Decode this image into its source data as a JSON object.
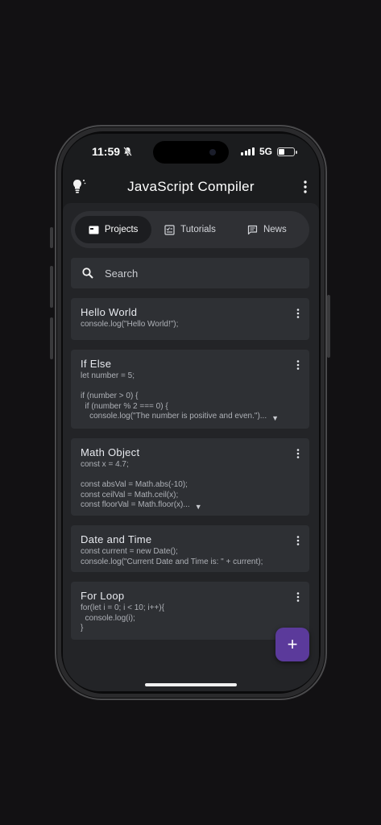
{
  "status_bar": {
    "time": "11:59",
    "network": "5G"
  },
  "app_bar": {
    "title": "JavaScript Compiler",
    "left_icon": "lightbulb-icon",
    "right_icon": "more-vert-icon"
  },
  "tabs": [
    {
      "label": "Projects",
      "icon": "folder-icon",
      "active": true
    },
    {
      "label": "Tutorials",
      "icon": "checklist-icon",
      "active": false
    },
    {
      "label": "News",
      "icon": "message-icon",
      "active": false
    }
  ],
  "search": {
    "placeholder": "Search"
  },
  "projects": [
    {
      "title": "Hello World",
      "code": "console.log(\"Hello World!\");",
      "expandable": false
    },
    {
      "title": "If Else",
      "code": "let number = 5;\n\nif (number > 0) {\n  if (number % 2 === 0) {\n    console.log(\"The number is positive and even.\")...",
      "expandable": true
    },
    {
      "title": "Math Object",
      "code": "const x = 4.7;\n\nconst absVal = Math.abs(-10);\nconst ceilVal = Math.ceil(x);\nconst floorVal = Math.floor(x)...",
      "expandable": true
    },
    {
      "title": "Date and Time",
      "code": "const current = new Date();\nconsole.log(\"Current Date and Time is: \" + current);",
      "expandable": false
    },
    {
      "title": "For Loop",
      "code": "for(let i = 0; i < 10; i++){\n  console.log(i);\n}",
      "expandable": false
    }
  ],
  "fab": {
    "label": "+"
  },
  "colors": {
    "accent": "#5b3a9b",
    "background": "#1b1c1e",
    "card": "#2e3034"
  }
}
